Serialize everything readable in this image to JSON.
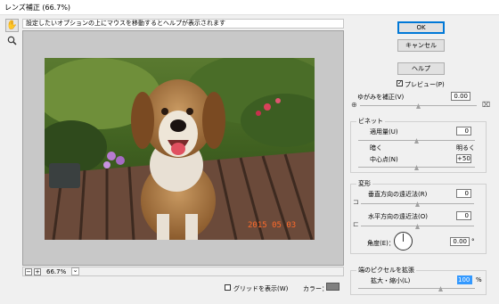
{
  "window": {
    "title": "レンズ補正 (66.7%)"
  },
  "hint": "設定したいオプションの上にマウスを移動するとヘルプが表示されます",
  "zoom": {
    "minus": "−",
    "plus": "+",
    "level": "66.7%",
    "dropdown": "⌄"
  },
  "photo": {
    "timestamp": "2015  05  03"
  },
  "footer": {
    "grid_label": "グリッドを表示(W)",
    "color_label": "カラー：",
    "grid_color": "#808080"
  },
  "buttons": {
    "ok": "OK",
    "cancel": "キャンセル",
    "help": "ヘルプ"
  },
  "preview": {
    "label": "プレビュー(P)",
    "checked": true
  },
  "distortion": {
    "label": "ゆがみを補正(V)",
    "value": "0.00",
    "level": 0.5
  },
  "vignette": {
    "title": "ビネット",
    "amount_label": "適用量(U)",
    "amount_value": "0",
    "amount_level": 0.5,
    "dark_label": "暗く",
    "light_label": "明るく",
    "midpoint_label": "中心点(N)",
    "midpoint_value": "+50",
    "midpoint_level": 0.5
  },
  "transform": {
    "title": "変形",
    "vertical_label": "垂直方向の遠近法(R)",
    "vertical_value": "0",
    "vertical_level": 0.5,
    "horizontal_label": "水平方向の遠近法(O)",
    "horizontal_value": "0",
    "horizontal_level": 0.5,
    "angle_label": "角度(E)：",
    "angle_value": "0.00",
    "angle_unit": "°"
  },
  "edge": {
    "title": "端のピクセルを拡張",
    "scale_label": "拡大・縮小(L)",
    "scale_value": "100",
    "scale_unit": "%",
    "scale_level": 0.5
  },
  "icons": [
    "hand-icon",
    "zoom-icon",
    "checkmark-icon",
    "pincushion-icon",
    "barrel-icon",
    "vertical-perspective-icon",
    "horizontal-perspective-icon",
    "angle-dial-icon"
  ]
}
